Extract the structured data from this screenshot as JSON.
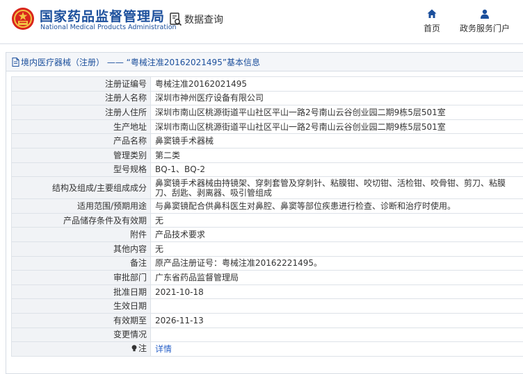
{
  "header": {
    "org_cn": "国家药品监督管理局",
    "org_en": "National Medical Products Administration",
    "search_label": "数据查询",
    "nav_home": "首页",
    "nav_services": "政务服务门户"
  },
  "panel": {
    "title": "境内医疗器械（注册） —— “粤械注准20162021495”基本信息"
  },
  "rows": [
    {
      "label": "注册证编号",
      "value": "粤械注准20162021495"
    },
    {
      "label": "注册人名称",
      "value": "深圳市神州医疗设备有限公司"
    },
    {
      "label": "注册人住所",
      "value": "深圳市南山区桃源街道平山社区平山一路2号南山云谷创业园二期9栋5层501室"
    },
    {
      "label": "生产地址",
      "value": "深圳市南山区桃源街道平山社区平山一路2号南山云谷创业园二期9栋5层501室"
    },
    {
      "label": "产品名称",
      "value": "鼻窦镜手术器械"
    },
    {
      "label": "管理类别",
      "value": "第二类"
    },
    {
      "label": "型号规格",
      "value": "BQ-1、BQ-2"
    },
    {
      "label": "结构及组成/主要组成成分",
      "value": "鼻窦镜手术器械由持镜架、穿刺套管及穿刺针、粘膜钳、咬切钳、活检钳、咬骨钳、剪刀、粘膜刀、刮匙、剥离器、吸引管组成"
    },
    {
      "label": "适用范围/预期用途",
      "value": "与鼻窦镜配合供鼻科医生对鼻腔、鼻窦等部位疾患进行检查、诊断和治疗时使用。"
    },
    {
      "label": "产品储存条件及有效期",
      "value": "无"
    },
    {
      "label": "附件",
      "value": "产品技术要求"
    },
    {
      "label": "其他内容",
      "value": "无"
    },
    {
      "label": "备注",
      "value": "原产品注册证号：粤械注准20162221495。"
    },
    {
      "label": "审批部门",
      "value": "广东省药品监督管理局"
    },
    {
      "label": "批准日期",
      "value": "2021-10-18"
    },
    {
      "label": "生效日期",
      "value": ""
    },
    {
      "label": "有效期至",
      "value": "2026-11-13"
    },
    {
      "label": "变更情况",
      "value": ""
    }
  ],
  "note": {
    "label": "注",
    "link": "详情"
  },
  "colors": {
    "brand_blue": "#1b4f9c",
    "emblem_red": "#d9261c",
    "link_blue": "#2a62c8"
  },
  "icons": [
    "national-emblem-icon",
    "search-doc-icon",
    "home-icon",
    "user-icon",
    "document-icon",
    "lightbulb-icon"
  ]
}
